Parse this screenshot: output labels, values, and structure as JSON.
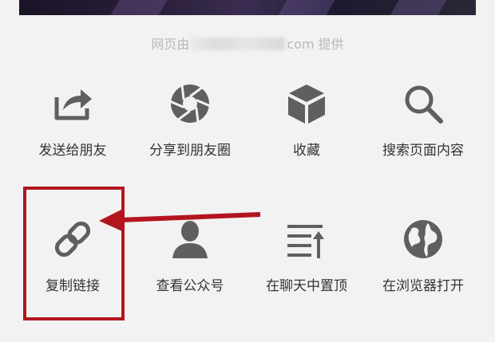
{
  "provider_notice": {
    "prefix": "网页由",
    "suffix": "com 提供"
  },
  "share_row": [
    {
      "label": "发送给朋友",
      "icon": "share-arrow-icon"
    },
    {
      "label": "分享到朋友圈",
      "icon": "camera-shutter-icon"
    },
    {
      "label": "收藏",
      "icon": "cube-icon"
    },
    {
      "label": "搜索页面内容",
      "icon": "search-icon"
    }
  ],
  "action_row": [
    {
      "label": "复制链接",
      "icon": "link-icon"
    },
    {
      "label": "查看公众号",
      "icon": "person-icon"
    },
    {
      "label": "在聊天中置顶",
      "icon": "pin-top-icon"
    },
    {
      "label": "在浏览器打开",
      "icon": "globe-icon"
    }
  ],
  "annotation": {
    "highlight_color": "#b3151f",
    "target": "复制链接"
  },
  "colors": {
    "icon": "#5f5f5f",
    "text": "#333333",
    "muted": "#b8b8b8",
    "sheet_background": "#f2f2f2"
  }
}
